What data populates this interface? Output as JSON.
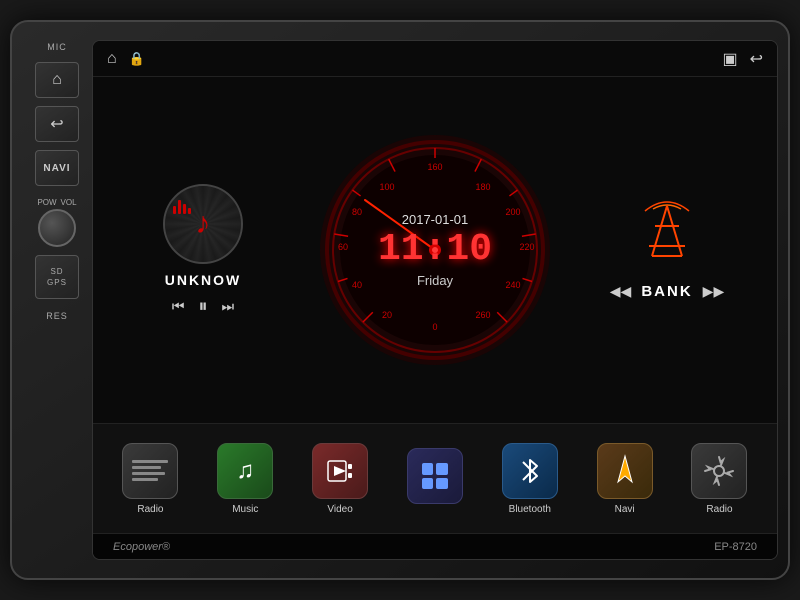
{
  "device": {
    "model": "EP-8720",
    "brand": "Ecopower"
  },
  "left_panel": {
    "mic_label": "MIC",
    "home_icon": "⌂",
    "back_icon": "↩",
    "navi_label": "NAVI",
    "pow_label": "POW",
    "vol_label": "VOL",
    "sd_label": "SD",
    "gps_label": "GPS",
    "res_label": "RES"
  },
  "top_bar": {
    "home_icon": "⌂",
    "lock_icon": "🔒",
    "window_icon": "▣",
    "back_icon": "↩"
  },
  "clock": {
    "date": "2017-01-01",
    "time": "11:10",
    "day": "Friday"
  },
  "music": {
    "track_name": "UNKNOW",
    "prev_icon": "⏮",
    "play_icon": "⏸",
    "next_icon": "⏭"
  },
  "radio": {
    "station": "BANK",
    "prev_icon": "◀◀",
    "next_icon": "▶▶"
  },
  "apps": [
    {
      "id": "radio",
      "label": "Radio",
      "icon": "radio"
    },
    {
      "id": "music",
      "label": "Music",
      "icon": "music"
    },
    {
      "id": "video",
      "label": "Video",
      "icon": "video"
    },
    {
      "id": "apps",
      "label": "",
      "icon": "apps"
    },
    {
      "id": "bluetooth",
      "label": "Bluetooth",
      "icon": "bluetooth"
    },
    {
      "id": "navi",
      "label": "Navi",
      "icon": "navi"
    },
    {
      "id": "settings",
      "label": "Radio",
      "icon": "settings"
    }
  ],
  "colors": {
    "accent": "#cc0000",
    "bg": "#0a0a0a",
    "text": "#ffffff"
  }
}
